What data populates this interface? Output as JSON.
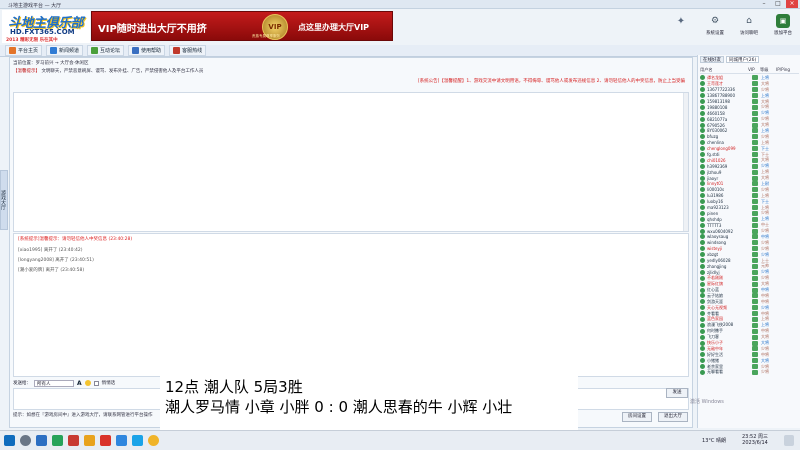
{
  "window": {
    "title": "斗地主游戏平台 — 大厅"
  },
  "banner": {
    "logo_main": "斗地主俱乐部",
    "logo_url": "HD.FXT365.COM",
    "logo_tag": "2013 精彩无限 乐在其中",
    "ad_left": "VIP随时进出大厅不用挤",
    "ad_right": "点这里办理大厅VIP",
    "ad_emblem": "VIP",
    "ad_sub": "贵族专属尊享服务"
  },
  "tray_buttons": [
    {
      "label": "系统设置",
      "icon": "gear-icon"
    },
    {
      "label": "访问聊吧",
      "icon": "home-icon"
    },
    {
      "label": "恩加平台",
      "icon": "platform-icon"
    }
  ],
  "toolbar": [
    {
      "label": "平台主页",
      "color": "#e3742a"
    },
    {
      "label": "新闻频道",
      "color": "#2f7bd4"
    },
    {
      "label": "互动论坛",
      "color": "#4a9f3a"
    },
    {
      "label": "使用帮助",
      "color": "#3a6fc1"
    },
    {
      "label": "客服热线",
      "color": "#c0392b"
    }
  ],
  "main": {
    "location": "当前位置：罗马前兴 → 大厅会·休闲区",
    "announce_label": "【温馨提示】",
    "announce": "文明聊天，严禁恶意刷屏、谩骂、发布外挂、广告，严禁侵害他人及平台工作人员",
    "system_notice": "[系统公告]【温馨提醒】1、游戏交流中请文明用语，不得侮辱、谩骂他人或发布违规信息  2、请勿轻信他人的中奖信息，防止上当受骗",
    "chat_lines": [
      {
        "text": "[系统提示]温馨提示：请勿轻信他人中奖信息 (23:40:28)",
        "red": true
      },
      {
        "text": "[xiao1995] 离开了 (23:40:42)",
        "red": false
      },
      {
        "text": "[longyang2008] 离开了 (23:40:51)",
        "red": false
      },
      {
        "text": "[潮小爱的牌] 离开了 (23:40:58)",
        "red": false
      }
    ],
    "send_to_label": "发送给：",
    "send_to_value": "所有人",
    "font_btn": "A",
    "private_label": "悄悄话",
    "send_button": "发送",
    "tips": "提示：如想在『游戏房间中』进入游戏大厅，请联系网管进行平台操作",
    "room_button": "房间设置",
    "exit_button": "退出大厅",
    "side_tab": "游戏大厅"
  },
  "right_panel": {
    "tabs": [
      "在线好友",
      "同城用户(26)"
    ],
    "columns": [
      "用户名",
      "VIP",
      "等级",
      "IP/Ping"
    ],
    "users": [
      {
        "name": "谭名龙姐",
        "red": true,
        "lv": "上将"
      },
      {
        "name": "王苛莲才",
        "red": true,
        "lv": "大将"
      },
      {
        "name": "13677722336",
        "red": false,
        "lv": "少将"
      },
      {
        "name": "13867788900",
        "red": false,
        "lv": "上将"
      },
      {
        "name": "159813198",
        "red": false,
        "lv": "大将"
      },
      {
        "name": "19880108",
        "red": false,
        "lv": "少将"
      },
      {
        "name": "4660158",
        "red": false,
        "lv": "少将"
      },
      {
        "name": "6821077a",
        "red": false,
        "lv": "少将"
      },
      {
        "name": "6790526",
        "red": false,
        "lv": "大将"
      },
      {
        "name": "8Y030062",
        "red": false,
        "lv": "上将"
      },
      {
        "name": "bfuzg",
        "red": false,
        "lv": "少将"
      },
      {
        "name": "chenlina",
        "red": false,
        "lv": "上将"
      },
      {
        "name": "chenglong099",
        "red": true,
        "lv": "下士"
      },
      {
        "name": "fg.stdi",
        "red": false,
        "lv": "下士"
      },
      {
        "name": "chi01026",
        "red": true,
        "lv": "大将"
      },
      {
        "name": "h3992369",
        "red": false,
        "lv": "少将"
      },
      {
        "name": "jlzhou9",
        "red": false,
        "lv": "上将"
      },
      {
        "name": "jiaoyr",
        "red": false,
        "lv": "大将"
      },
      {
        "name": "linnyt01",
        "red": true,
        "lv": "上尉"
      },
      {
        "name": "li00010s",
        "red": false,
        "lv": "少将"
      },
      {
        "name": "lu31986",
        "red": false,
        "lv": "上将"
      },
      {
        "name": "luoby16",
        "red": false,
        "lv": "下士"
      },
      {
        "name": "ma923123",
        "red": false,
        "lv": "上将"
      },
      {
        "name": "pinen",
        "red": false,
        "lv": "少将"
      },
      {
        "name": "qhshdp",
        "red": false,
        "lv": "上将"
      },
      {
        "name": "TTTTT3",
        "red": false,
        "lv": "中士"
      },
      {
        "name": "wxu0604092",
        "red": false,
        "lv": "少将"
      },
      {
        "name": "wlaoysaug",
        "red": false,
        "lv": "中将"
      },
      {
        "name": "windsong",
        "red": false,
        "lv": "少将"
      },
      {
        "name": "wisteyji",
        "red": true,
        "lv": "少将"
      },
      {
        "name": "xbzgt",
        "red": false,
        "lv": "少将"
      },
      {
        "name": "yedly06028",
        "red": false,
        "lv": "上士"
      },
      {
        "name": "zhangjing",
        "red": false,
        "lv": "元帅"
      },
      {
        "name": "zjlidlyj",
        "red": false,
        "lv": "少将"
      },
      {
        "name": "不若刚刚",
        "red": true,
        "lv": "少将"
      },
      {
        "name": "星际红旗",
        "red": true,
        "lv": "大将"
      },
      {
        "name": "红心蓝",
        "red": false,
        "lv": "中将"
      },
      {
        "name": "云子姑娘",
        "red": false,
        "lv": "中将"
      },
      {
        "name": "剑游天涯",
        "red": false,
        "lv": "中将"
      },
      {
        "name": "天心无视频",
        "red": true,
        "lv": "少将"
      },
      {
        "name": "齐看看",
        "red": false,
        "lv": "中将"
      },
      {
        "name": "蓝色家园",
        "red": true,
        "lv": "上将"
      },
      {
        "name": "浪漫飞侠2008",
        "red": false,
        "lv": "上将"
      },
      {
        "name": "何时撒手",
        "red": false,
        "lv": "中将"
      },
      {
        "name": "飞刀客",
        "red": false,
        "lv": "大将"
      },
      {
        "name": "快乐小子",
        "red": true,
        "lv": "大将"
      },
      {
        "name": "无敌中年",
        "red": true,
        "lv": "少将"
      },
      {
        "name": "好好生活",
        "red": false,
        "lv": "中将"
      },
      {
        "name": "小猪猪",
        "red": false,
        "lv": "大将"
      },
      {
        "name": "老余家里",
        "red": false,
        "lv": "少将"
      },
      {
        "name": "无聊看看",
        "red": false,
        "lv": "少将"
      }
    ]
  },
  "overlay": {
    "line1": "12点                 潮人队                 5局3胜",
    "line2": "潮人罗马情 小章 小胖  0  :  0  潮人思春的牛 小辉 小壮"
  },
  "activate": "激活 Windows",
  "taskbar": {
    "temp": "13°C 晴朗",
    "time": "23:52 周三",
    "date": "2023/6/14"
  }
}
